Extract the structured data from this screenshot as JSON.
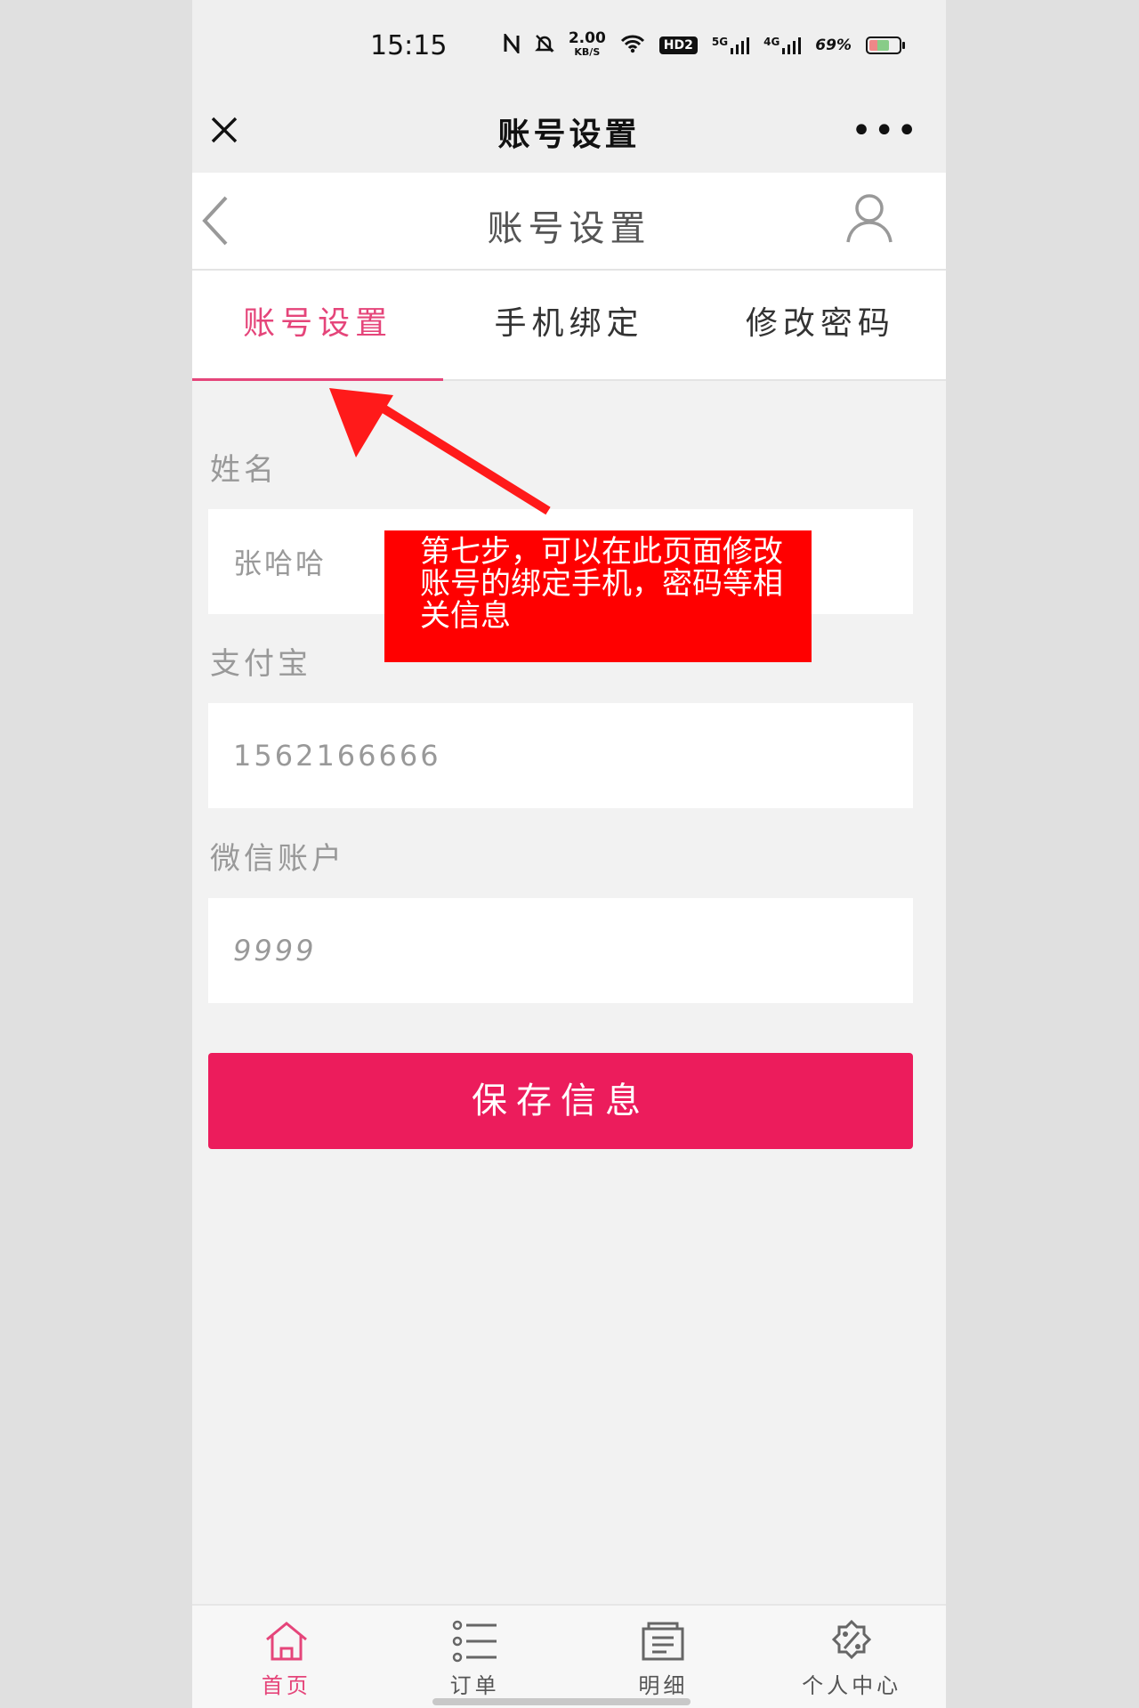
{
  "status_bar": {
    "time": "15:15",
    "speed_value": "2.00",
    "speed_unit": "KB/S",
    "hd_label": "HD2",
    "net1": "5G",
    "net2": "4G",
    "battery_text": "69%"
  },
  "wechat_bar": {
    "title": "账号设置",
    "more_label": "•••"
  },
  "app_header": {
    "title": "账号设置"
  },
  "tabs": [
    {
      "label": "账号设置",
      "active": true
    },
    {
      "label": "手机绑定",
      "active": false
    },
    {
      "label": "修改密码",
      "active": false
    }
  ],
  "form": {
    "name_label": "姓名",
    "name_value": "张哈哈",
    "alipay_label": "支付宝",
    "alipay_value": "1562166666",
    "wechat_label": "微信账户",
    "wechat_value": "9999",
    "save_label": "保存信息"
  },
  "annotation": {
    "text": "第七步，可以在此页面修改账号的绑定手机，密码等相关信息"
  },
  "bottom_nav": [
    {
      "label": "首页",
      "icon": "home-icon",
      "active": true
    },
    {
      "label": "订单",
      "icon": "list-icon",
      "active": false
    },
    {
      "label": "明细",
      "icon": "receipt-icon",
      "active": false
    },
    {
      "label": "个人中心",
      "icon": "discount-icon",
      "active": false
    }
  ],
  "colors": {
    "accent": "#e5457a",
    "button": "#ec1c5c",
    "annotation": "#ff0000"
  }
}
